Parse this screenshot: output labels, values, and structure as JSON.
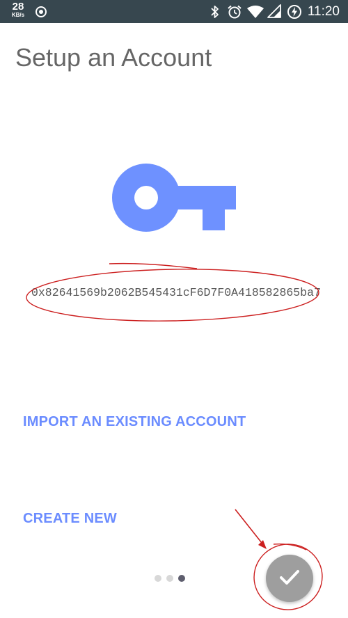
{
  "status_bar": {
    "net_speed_value": "28",
    "net_speed_unit": "KB/s",
    "time": "11:20",
    "icons": [
      "record-icon",
      "bluetooth-icon",
      "alarm-icon",
      "wifi-icon",
      "signal-icon",
      "battery-charging-icon"
    ]
  },
  "page": {
    "title": "Setup an Account"
  },
  "account": {
    "icon": "key-icon",
    "address": "0x82641569b2062B545431cF6D7F0A418582865ba7"
  },
  "actions": {
    "import_label": "IMPORT AN EXISTING ACCOUNT",
    "create_label": "CREATE NEW"
  },
  "pager": {
    "total": 3,
    "active_index": 2
  },
  "fab": {
    "icon": "checkmark-icon"
  },
  "colors": {
    "status_bar_bg": "#37474f",
    "accent": "#6b8cff",
    "fab_bg": "#9e9e9e",
    "annotation_red": "#cc1f1f",
    "title_text": "#666666"
  }
}
